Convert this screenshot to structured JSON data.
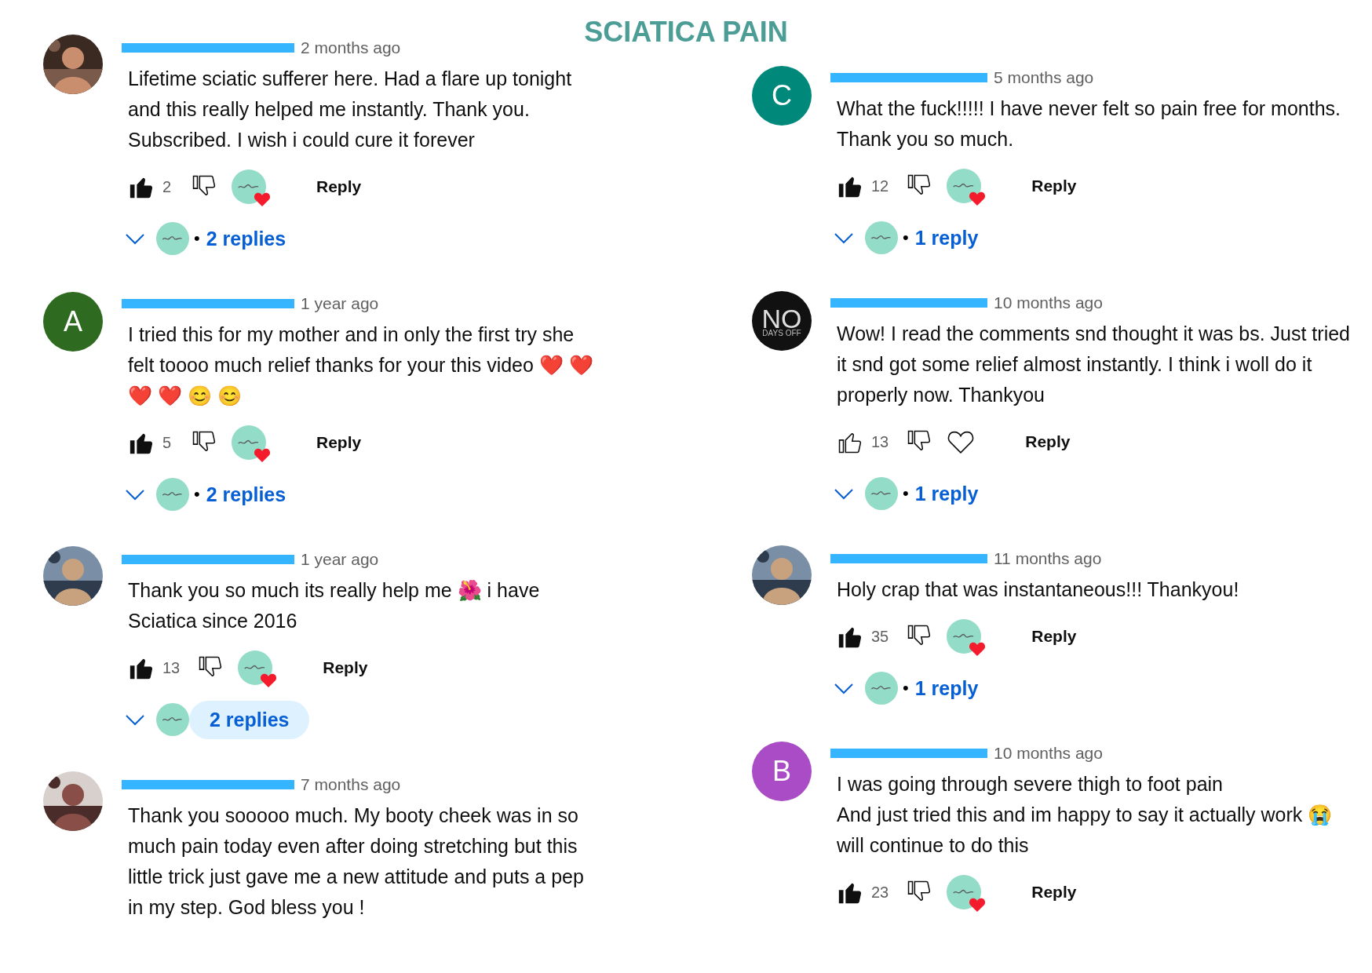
{
  "title": "SCIATICA PAIN",
  "columns": [
    {
      "comments": [
        {
          "author_redacted": true,
          "time": "2 months ago",
          "text": "Lifetime sciatic sufferer here. Had a flare up tonight and this really helped me instantly. Thank you. Subscribed. I wish i could cure it forever",
          "liked": true,
          "likes": "2",
          "creator_hearted": true,
          "reply": "Reply",
          "replies": {
            "bullet": "•",
            "label": "2 replies",
            "highlighted": false
          }
        },
        {
          "avatar": {
            "kind": "letter",
            "letter": "A",
            "color": "#2e6a1f"
          },
          "author_redacted": true,
          "time": "1 year ago",
          "text": "I tried this for my mother and in only the first try she felt toooo much relief thanks for your this video ❤️ ❤️ ❤️ ❤️ 😊 😊",
          "liked": true,
          "likes": "5",
          "creator_hearted": true,
          "reply": "Reply",
          "replies": {
            "bullet": "•",
            "label": "2 replies",
            "highlighted": false
          }
        },
        {
          "author_redacted": true,
          "time": "1 year ago",
          "text": "Thank you so much its really help me 🌺 i have Sciatica since 2016",
          "liked": true,
          "likes": "13",
          "creator_hearted": true,
          "reply": "Reply",
          "replies": {
            "label": "2 replies",
            "highlighted": true
          }
        },
        {
          "author_redacted": true,
          "time": "7 months ago",
          "text": "Thank you sooooo much. My booty cheek was in so much pain today even after doing stretching but this little trick just gave me a new attitude and puts a pep in my step. God bless you !"
        }
      ]
    },
    {
      "comments": [
        {
          "avatar": {
            "kind": "letter",
            "letter": "C",
            "color": "#00897b"
          },
          "author_redacted": true,
          "time": "5 months ago",
          "text": "What the fuck!!!!! I have never felt so pain free for months. Thank you so much.",
          "liked": true,
          "likes": "12",
          "creator_hearted": true,
          "reply": "Reply",
          "replies": {
            "bullet": "•",
            "label": "1 reply",
            "highlighted": false
          }
        },
        {
          "avatar": {
            "kind": "logo",
            "text": "NO",
            "subtext": "DAYS OFF"
          },
          "author_redacted": true,
          "time": "10 months ago",
          "text": "Wow! I read the comments snd thought it was bs. Just tried it snd got some relief almost instantly. I think i woll do it properly now. Thankyou",
          "liked": false,
          "likes": "13",
          "creator_hearted": false,
          "reply": "Reply",
          "replies": {
            "bullet": "•",
            "label": "1 reply",
            "highlighted": false
          }
        },
        {
          "author_redacted": true,
          "time": "11 months ago",
          "text": "Holy crap that was instantaneous!!! Thankyou!",
          "liked": true,
          "likes": "35",
          "creator_hearted": true,
          "reply": "Reply",
          "replies": {
            "bullet": "•",
            "label": "1 reply",
            "highlighted": false
          }
        },
        {
          "avatar": {
            "kind": "letter",
            "letter": "B",
            "color": "#a94cc6"
          },
          "author_redacted": true,
          "time": "10 months ago",
          "text": "I was going through severe thigh to foot pain\nAnd just tried this and im happy to say it actually work 😭 will continue to do this",
          "liked": true,
          "likes": "23",
          "creator_hearted": true,
          "reply": "Reply"
        }
      ]
    }
  ]
}
